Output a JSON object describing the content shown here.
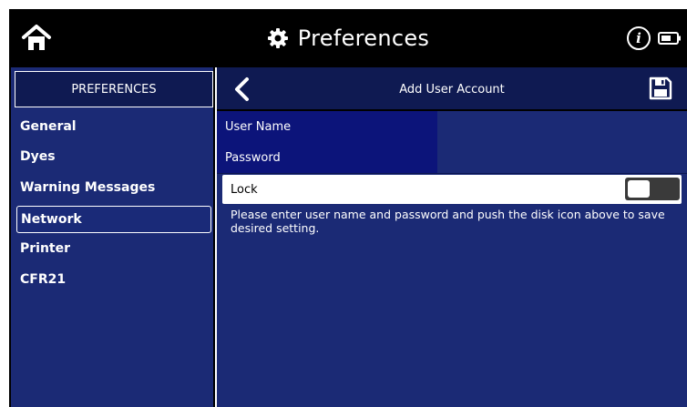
{
  "topbar": {
    "title": "Preferences",
    "icons": {
      "home": "home-icon",
      "gear": "gear-icon",
      "info": "info-icon",
      "battery": "battery-icon"
    },
    "info_glyph": "i"
  },
  "sidebar": {
    "header": "PREFERENCES",
    "items": [
      {
        "label": "General",
        "active": false
      },
      {
        "label": "Dyes",
        "active": false
      },
      {
        "label": "Warning Messages",
        "active": false
      },
      {
        "label": "Network",
        "active": true
      },
      {
        "label": "Printer",
        "active": false
      },
      {
        "label": "CFR21",
        "active": false
      }
    ]
  },
  "main": {
    "title": "Add User Account",
    "icons": {
      "back": "chevron-left-icon",
      "save": "floppy-disk-icon"
    },
    "fields": {
      "user_name": {
        "label": "User Name",
        "value": ""
      },
      "password": {
        "label": "Password",
        "value": ""
      }
    },
    "lock": {
      "label": "Lock",
      "enabled": false
    },
    "instruction": "Please enter user name and password and push the disk icon above to save desired setting."
  },
  "colors": {
    "topbar": "#000000",
    "panel": "#1b2a75",
    "panel_dark": "#0f1a52",
    "label_cell": "#0c147a",
    "text": "#ffffff",
    "toggle_off": "#3a3a3a"
  }
}
